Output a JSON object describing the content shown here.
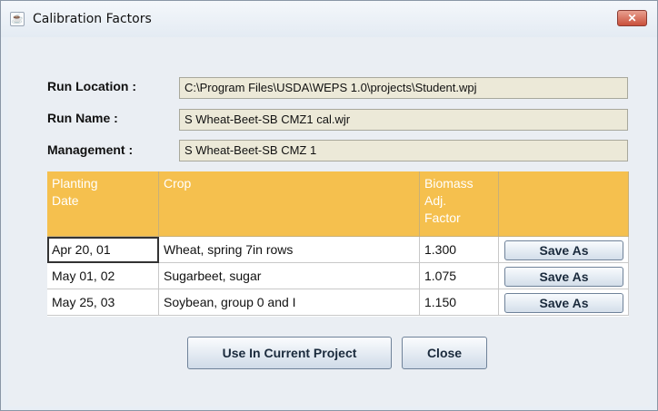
{
  "window": {
    "title": "Calibration Factors",
    "close_glyph": "✕",
    "icon": "java-cup-icon"
  },
  "fields": {
    "run_location_label": "Run Location :",
    "run_location_value": "C:\\Program Files\\USDA\\WEPS 1.0\\projects\\Student.wpj",
    "run_name_label": "Run Name :",
    "run_name_value": "S Wheat-Beet-SB CMZ1 cal.wjr",
    "management_label": "Management :",
    "management_value": "S Wheat-Beet-SB CMZ 1"
  },
  "table": {
    "headers": [
      "Planting Date",
      "Crop",
      "Biomass Adj. Factor",
      ""
    ],
    "header_lines": {
      "planting": [
        "Planting",
        "Date"
      ],
      "crop": [
        "Crop"
      ],
      "biomass": [
        "Biomass",
        "Adj.",
        "Factor"
      ]
    },
    "rows": [
      {
        "date": "Apr 20, 01",
        "crop": "Wheat, spring 7in rows",
        "factor": "1.300",
        "action": "Save As"
      },
      {
        "date": "May 01, 02",
        "crop": "Sugarbeet, sugar",
        "factor": "1.075",
        "action": "Save As"
      },
      {
        "date": "May 25, 03",
        "crop": "Soybean, group 0 and I",
        "factor": "1.150",
        "action": "Save As"
      }
    ],
    "header_color": "#f5c04e"
  },
  "buttons": {
    "use_current": "Use In Current Project",
    "close": "Close"
  }
}
